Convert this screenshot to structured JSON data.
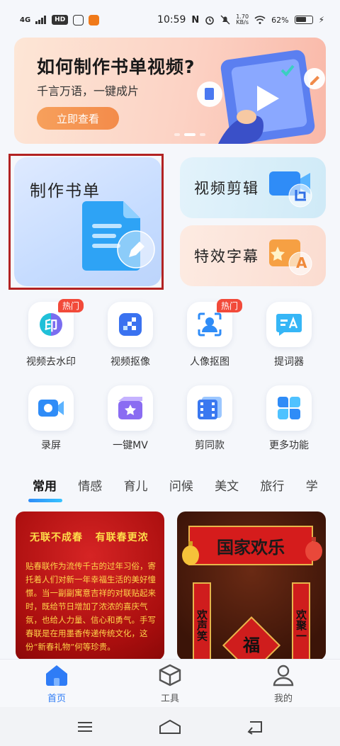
{
  "status_bar": {
    "network": "4G",
    "hd_badge": "HD",
    "time": "10:59",
    "net_speed_value": "1.70",
    "net_speed_unit": "KB/s",
    "battery": "62%",
    "battery_level": 0.62
  },
  "banner": {
    "title": "如何制作书单视频?",
    "subtitle": "千言万语，一键成片",
    "button": "立即查看"
  },
  "features": {
    "main": "制作书单",
    "video_edit": "视频剪辑",
    "subtitles": "特效字幕",
    "subtitle_icon_letter": "A"
  },
  "tools": [
    {
      "label": "视频去水印",
      "icon": "watermark-remove-icon",
      "badge": "热门",
      "glyph": "印"
    },
    {
      "label": "视频抠像",
      "icon": "video-cutout-icon",
      "badge": ""
    },
    {
      "label": "人像抠图",
      "icon": "portrait-cutout-icon",
      "badge": "热门"
    },
    {
      "label": "提词器",
      "icon": "teleprompter-icon",
      "badge": ""
    },
    {
      "label": "录屏",
      "icon": "screen-record-icon",
      "badge": ""
    },
    {
      "label": "一键MV",
      "icon": "one-click-mv-icon",
      "badge": ""
    },
    {
      "label": "剪同款",
      "icon": "same-template-icon",
      "badge": ""
    },
    {
      "label": "更多功能",
      "icon": "more-features-icon",
      "badge": ""
    }
  ],
  "tabs": [
    "常用",
    "情感",
    "育儿",
    "问候",
    "美文",
    "旅行",
    "学"
  ],
  "templates": [
    {
      "headline_left": "无联不成春",
      "headline_right": "有联春更浓",
      "body": "贴春联作为流传千古的过年习俗，寄托着人们对新一年幸福生活的美好憧憬。当一副副寓意吉祥的对联贴起来时，既给节日增加了浓浓的喜庆气氛，也给人力量、信心和勇气。手写春联是在用墨香传递传统文化，这份“新春礼物”何等珍贵。"
    },
    {
      "banner": "国家欢乐",
      "couplet_left": "欢声笑",
      "couplet_right": "欢聚一",
      "fu": "福"
    }
  ],
  "bottom_nav": [
    {
      "label": "首页",
      "icon": "home-icon"
    },
    {
      "label": "工具",
      "icon": "toolbox-icon"
    },
    {
      "label": "我的",
      "icon": "profile-icon"
    }
  ],
  "colors": {
    "accent": "#2f7cf6",
    "hot_badge": "#f24a3a",
    "banner_button": "#f38b4a"
  }
}
